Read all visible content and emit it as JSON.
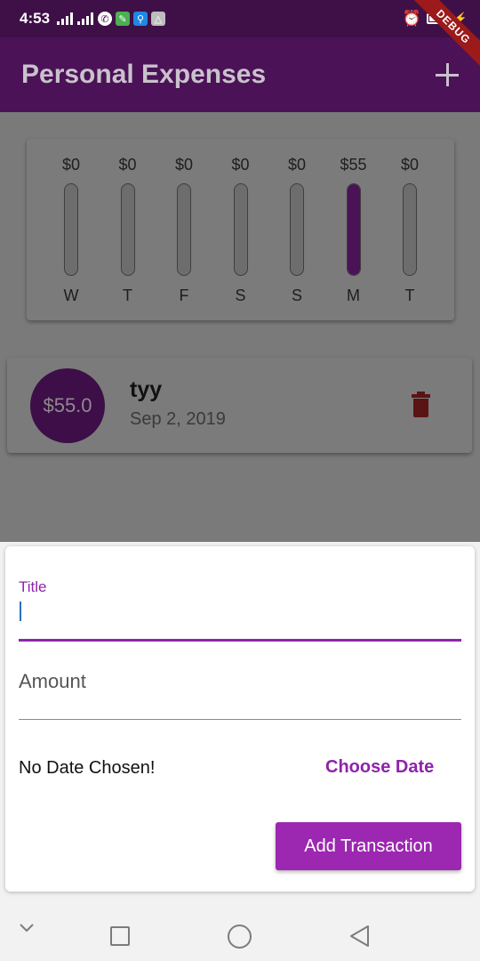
{
  "status_bar": {
    "time": "4:53",
    "debug_label": "DEBUG"
  },
  "app_bar": {
    "title": "Personal Expenses",
    "add_icon": "plus-icon"
  },
  "chart": {
    "accent_color": "#4b1257",
    "bars": [
      {
        "day": "W",
        "amount": "$0",
        "fill": 0
      },
      {
        "day": "T",
        "amount": "$0",
        "fill": 0
      },
      {
        "day": "F",
        "amount": "$0",
        "fill": 0
      },
      {
        "day": "S",
        "amount": "$0",
        "fill": 0
      },
      {
        "day": "S",
        "amount": "$0",
        "fill": 0
      },
      {
        "day": "M",
        "amount": "$55",
        "fill": 1
      },
      {
        "day": "T",
        "amount": "$0",
        "fill": 0
      }
    ]
  },
  "transactions": [
    {
      "amount": "$55.0",
      "title": "tyy",
      "date": "Sep 2, 2019",
      "delete_icon": "trash-icon",
      "delete_color": "#b71c1c"
    }
  ],
  "form": {
    "title_label": "Title",
    "amount_placeholder": "Amount",
    "date_status": "No Date Chosen!",
    "choose_date_label": "Choose Date",
    "submit_label": "Add Transaction",
    "accent_color": "#8e24aa",
    "button_color": "#9c27b0"
  },
  "nav_bar": {
    "icons": [
      "chevron-down-icon",
      "recents-square-icon",
      "home-circle-icon",
      "back-triangle-icon"
    ]
  }
}
